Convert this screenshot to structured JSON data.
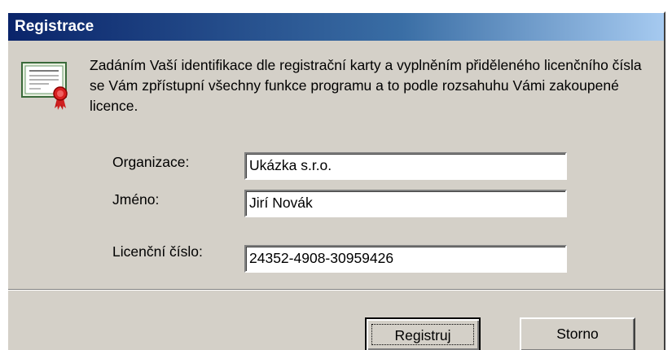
{
  "window": {
    "title": "Registrace"
  },
  "intro": {
    "icon": "certificate-icon",
    "text": "Zadáním Vaší identifikace dle registrační karty a vyplněním přiděleného licenčního čísla se Vám zpřístupní všechny funkce programu a to podle rozsahuhu Vámi zakoupené licence."
  },
  "form": {
    "organization_label": "Organizace:",
    "organization_value": "Ukázka s.r.o.",
    "name_label": "Jméno:",
    "name_value": "Jirí Novák",
    "license_label": "Licenční číslo:",
    "license_value": "24352-4908-30959426"
  },
  "buttons": {
    "register_label": "Registruj",
    "cancel_label": "Storno"
  },
  "colors": {
    "title_bar": "#0a246a",
    "dialog_face": "#d4d0c8"
  }
}
